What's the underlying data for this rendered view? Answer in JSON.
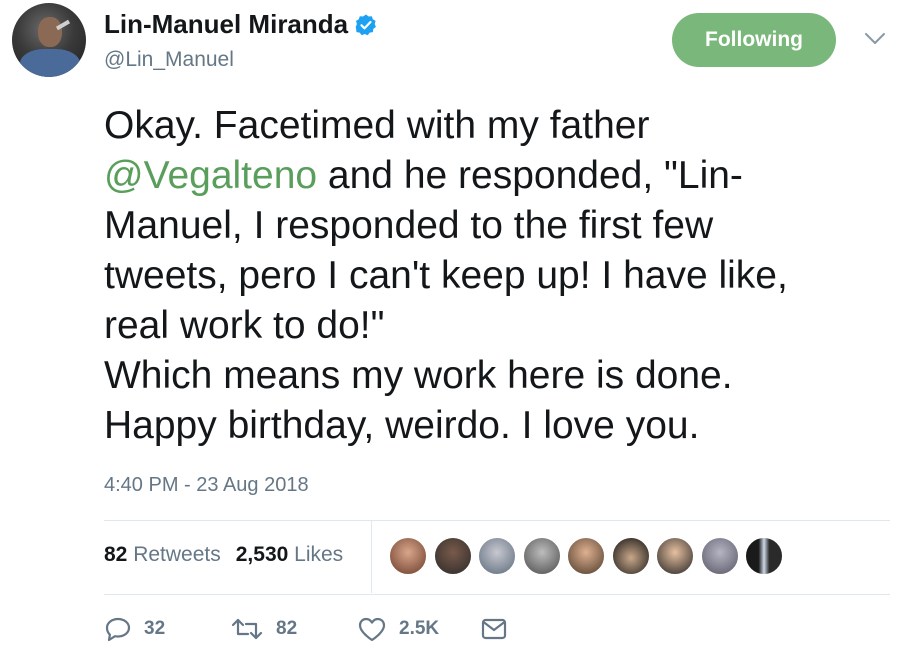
{
  "author": {
    "name": "Lin-Manuel Miranda",
    "handle": "@Lin_Manuel",
    "verified": true
  },
  "follow_button": {
    "label": "Following",
    "color": "#79b77a"
  },
  "tweet": {
    "line1": "Okay. Facetimed with my father",
    "mention": "@Vegalteno",
    "line2_rest": " and he responded, \"Lin-",
    "line3": "Manuel, I responded to the first few",
    "line4": "tweets, pero I can't keep up! I have like,",
    "line5": "real work to do!\"",
    "line6": "Which means my work here is done.",
    "line7": "Happy birthday, weirdo. I love you."
  },
  "timestamp": "4:40 PM - 23 Aug 2018",
  "stats": {
    "retweets_count": "82",
    "retweets_label": "Retweets",
    "likes_count": "2,530",
    "likes_label": "Likes"
  },
  "actions": {
    "reply_count": "32",
    "retweet_count": "82",
    "like_count": "2.5K"
  },
  "icons": [
    "verified-badge-icon",
    "chevron-down-icon",
    "reply-icon",
    "retweet-icon",
    "like-icon",
    "message-icon"
  ],
  "colors": {
    "mention": "#5a9e5c",
    "secondary_text": "#657786",
    "verified": "#1da1f2"
  }
}
